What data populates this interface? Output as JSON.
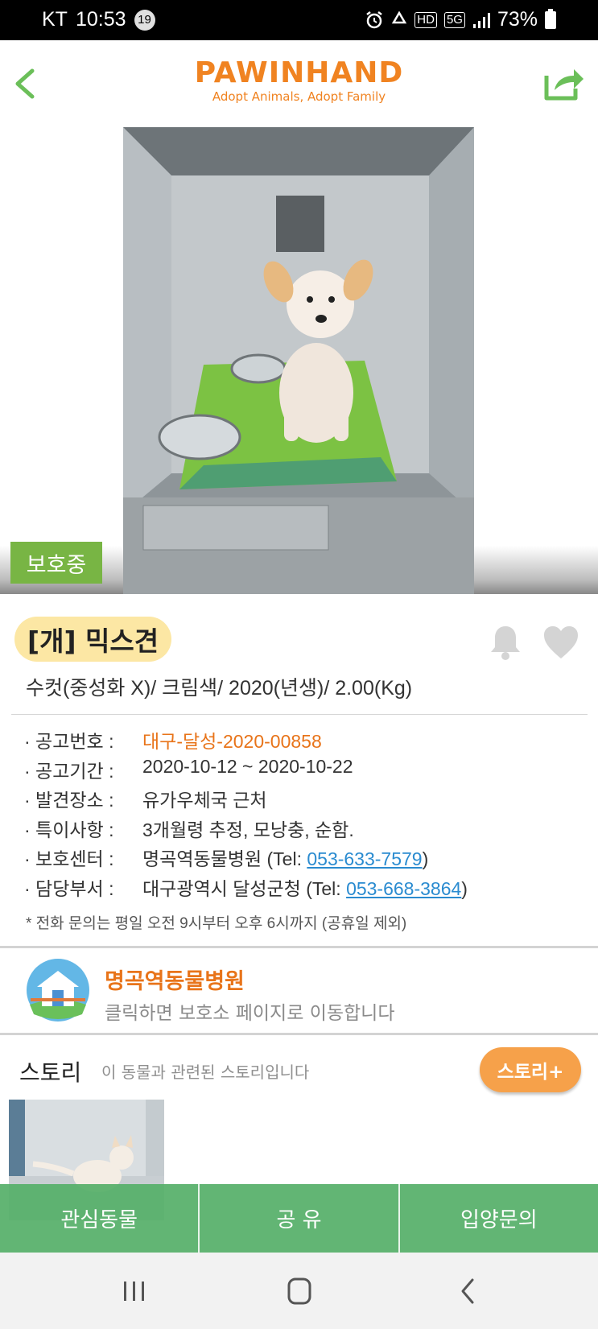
{
  "status_bar": {
    "carrier": "KT",
    "time": "10:53",
    "notification_count": "19",
    "network": "HD",
    "signal_type": "5G",
    "battery": "73%"
  },
  "header": {
    "logo_title": "PAWINHAND",
    "logo_subtitle": "Adopt Animals, Adopt Family"
  },
  "photo": {
    "status_tag": "보호중"
  },
  "animal": {
    "title": "[개] 믹스견",
    "summary": "수컷(중성화 X)/ 크림색/ 2020(년생)/ 2.00(Kg)"
  },
  "info": {
    "notice_no_label": "· 공고번호 :",
    "notice_no": "대구-달성-2020-00858",
    "period_label": "· 공고기간 :",
    "period": "2020-10-12 ~ 2020-10-22",
    "found_label": "· 발견장소 :",
    "found": "유가우체국 근처",
    "special_label": "· 특이사항 :",
    "special": "3개월령 추정, 모낭충, 순함.",
    "center_label": "· 보호센터 :",
    "center_name": "명곡역동물병원 (Tel: ",
    "center_tel": "053-633-7579",
    "center_close": ")",
    "dept_label": "· 담당부서 :",
    "dept_name": "대구광역시 달성군청 (Tel: ",
    "dept_tel": "053-668-3864",
    "dept_close": ")",
    "notice": "* 전화 문의는 평일 오전 9시부터 오후 6시까지 (공휴일 제외)"
  },
  "shelter": {
    "name": "명곡역동물병원",
    "description": "클릭하면 보호소 페이지로 이동합니다"
  },
  "story": {
    "title": "스토리",
    "description": "이 동물과 관련된 스토리입니다",
    "button": "스토리+"
  },
  "actions": {
    "interest": "관심동물",
    "share": "공 유",
    "adopt_inquiry": "입양문의"
  },
  "colors": {
    "brand_orange": "#f08321",
    "brand_green": "#78b544",
    "action_green": "#56af69",
    "link_blue": "#2a8bd0"
  }
}
